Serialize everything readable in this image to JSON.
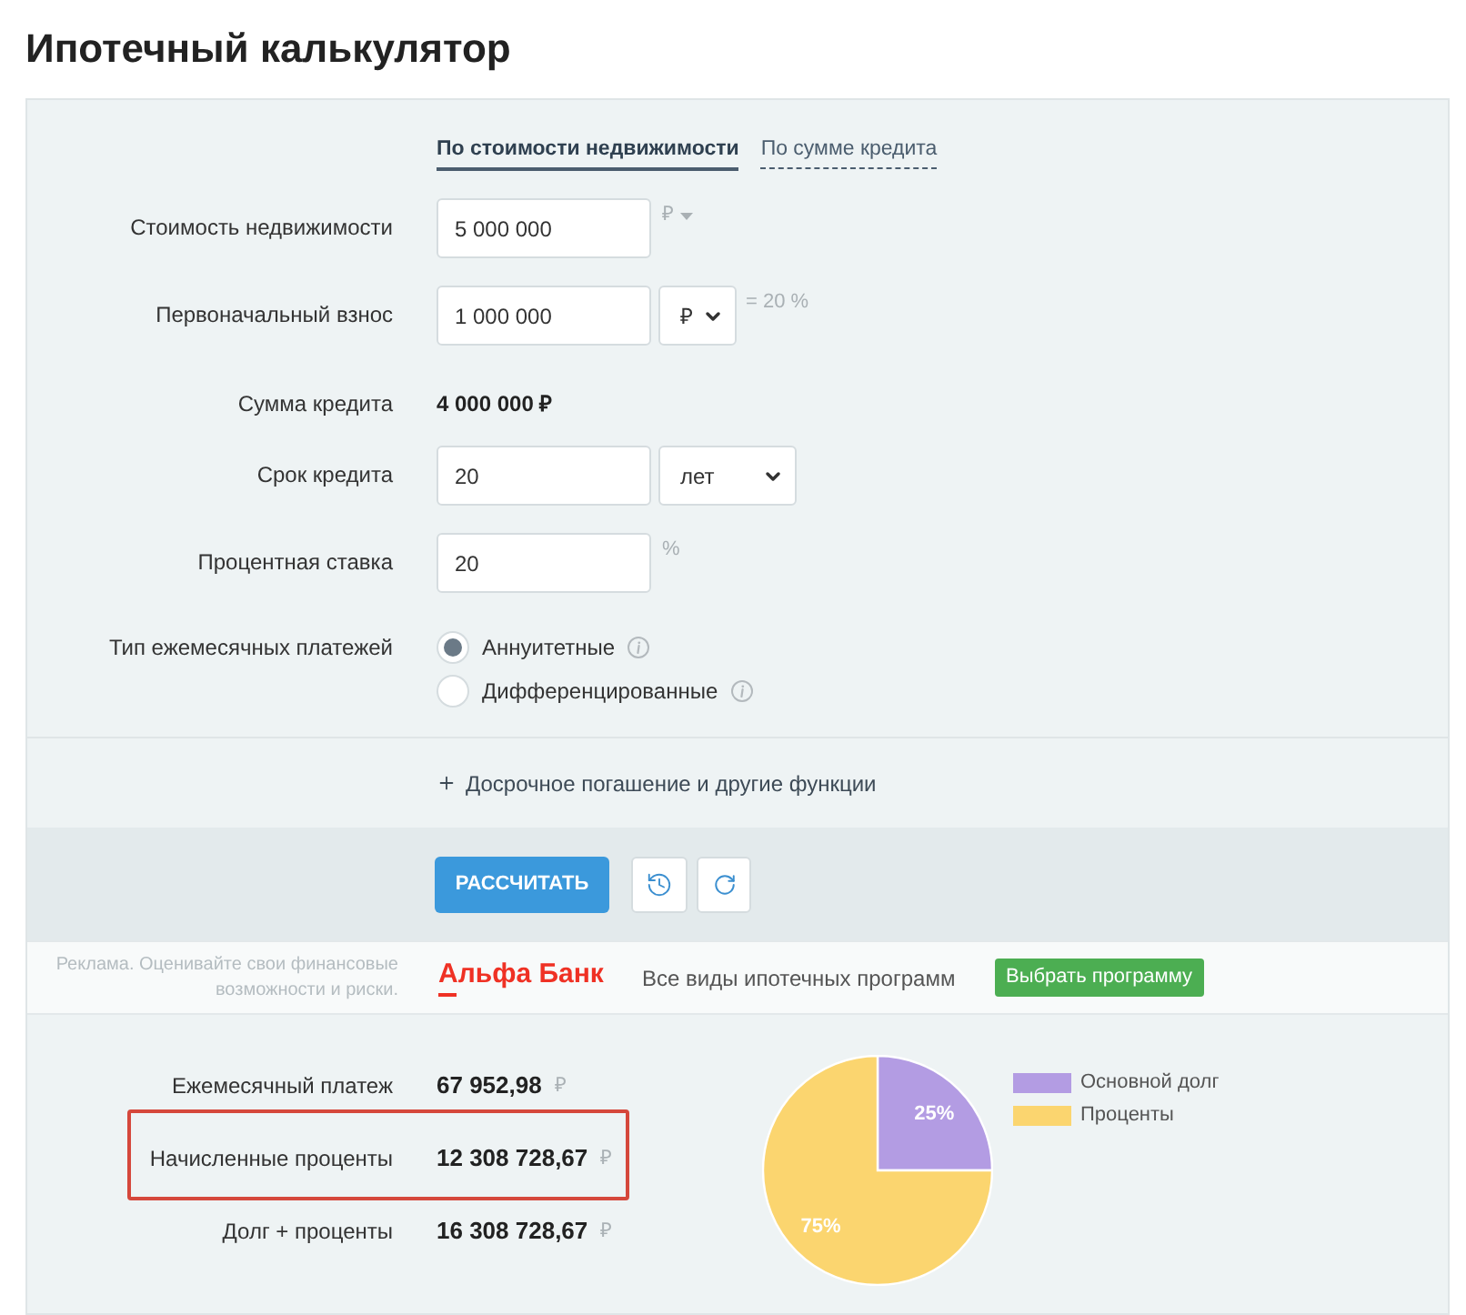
{
  "title": "Ипотечный калькулятор",
  "tabs": [
    {
      "label": "По стоимости недвижимости",
      "selected": true
    },
    {
      "label": "По сумме кредита",
      "selected": false
    }
  ],
  "form": [
    {
      "kind": "input",
      "label": "Стоимость недвижимости",
      "value": "5 000 000",
      "suffix": "₽",
      "suffix_dropdown": true
    },
    {
      "kind": "input_select",
      "label": "Первоначальный взнос",
      "value": "1 000 000",
      "select": "₽",
      "note": "= 20 %"
    },
    {
      "kind": "static",
      "label": "Сумма кредита",
      "value": "4 000 000 ₽"
    },
    {
      "kind": "input_select",
      "label": "Срок кредита",
      "value": "20",
      "select": "лет"
    },
    {
      "kind": "input",
      "label": "Процентная ставка",
      "value": "20",
      "suffix": "%"
    },
    {
      "kind": "radio",
      "label": "Тип ежемесячных платежей",
      "options": [
        {
          "label": "Аннуитетные",
          "selected": true,
          "info": true
        },
        {
          "label": "Дифференцированные",
          "selected": false,
          "info": true
        }
      ]
    }
  ],
  "more_options": {
    "label": "Досрочное погашение и другие функции"
  },
  "actions": {
    "calculate": "РАССЧИТАТЬ"
  },
  "ad": {
    "disclaimer": "Реклама. Оценивайте свои финансовые возможности и риски.",
    "bank": "Альфа Банк",
    "text": "Все виды ипотечных программ",
    "button": "Выбрать программу"
  },
  "results": {
    "rows": [
      {
        "label": "Ежемесячный платеж",
        "value": "67 952,98",
        "currency": "₽",
        "highlighted": false
      },
      {
        "label": "Начисленные проценты",
        "value": "12 308 728,67",
        "currency": "₽",
        "highlighted": true
      },
      {
        "label": "Долг + проценты",
        "value": "16 308 728,67",
        "currency": "₽",
        "highlighted": false
      }
    ],
    "chart_data": {
      "type": "pie",
      "categories": [
        "Основной долг",
        "Проценты"
      ],
      "values": [
        25,
        75
      ],
      "colors": [
        "#b39ce3",
        "#fbd56f"
      ],
      "value_labels": [
        "25%",
        "75%"
      ]
    }
  }
}
